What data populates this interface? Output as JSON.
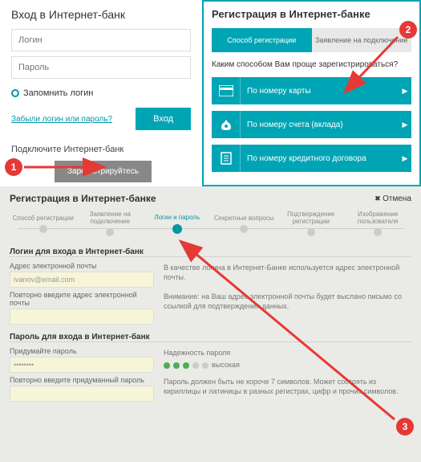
{
  "login": {
    "title": "Вход в Интернет-банк",
    "loginPlaceholder": "Логин",
    "passwordPlaceholder": "Пароль",
    "remember": "Запомнить логин",
    "forgot": "Забыли логин или пароль?",
    "loginBtn": "Вход",
    "connect": "Подключите Интернет-банк",
    "registerBtn": "Зарегистрируйтесь"
  },
  "reg": {
    "title": "Регистрация в Интернет-банке",
    "tab1": "Способ регистрации",
    "tab2": "Заявление на подключение",
    "prompt": "Каким способом Вам проще зарегистрироваться?",
    "m1": "По номеру карты",
    "m2": "По номеру счета (вклада)",
    "m3": "По номеру кредитного договора"
  },
  "badges": {
    "b1": "1",
    "b2": "2",
    "b3": "3"
  },
  "bottom": {
    "title": "Регистрация в Интернет-банке",
    "cancel": "Отмена",
    "steps": {
      "s1": "Способ регистрации",
      "s2": "Заявление на подключение",
      "s3": "Логин и пароль",
      "s4": "Секретные вопросы",
      "s5": "Подтверждение регистрации",
      "s6": "Изображение пользователя"
    },
    "loginSection": "Логин для входа в Интернет-банк",
    "emailLabel": "Адрес электронной почты",
    "emailValue": "ivanov@email.com",
    "email2Label": "Повторно введите адрес электронной почты",
    "emailNote1": "В качестве логина в Интернет-Банке используется адрес электронной почты.",
    "emailNote2": "Внимание: на Ваш адрес электронной почты будет выслано письмо со ссылкой для подтверждения данных.",
    "passSection": "Пароль для входа в Интернет-банк",
    "passLabel": "Придумайте пароль",
    "passValue": "••••••••",
    "strengthLabel": "Надежность пароля",
    "strengthText": "высокая",
    "pass2Label": "Повторно введите придуманный пароль",
    "passNote": "Пароль должен быть не короче 7 символов. Может состоять из кириллицы и латиницы в разных регистрах, цифр и прочих символов."
  }
}
